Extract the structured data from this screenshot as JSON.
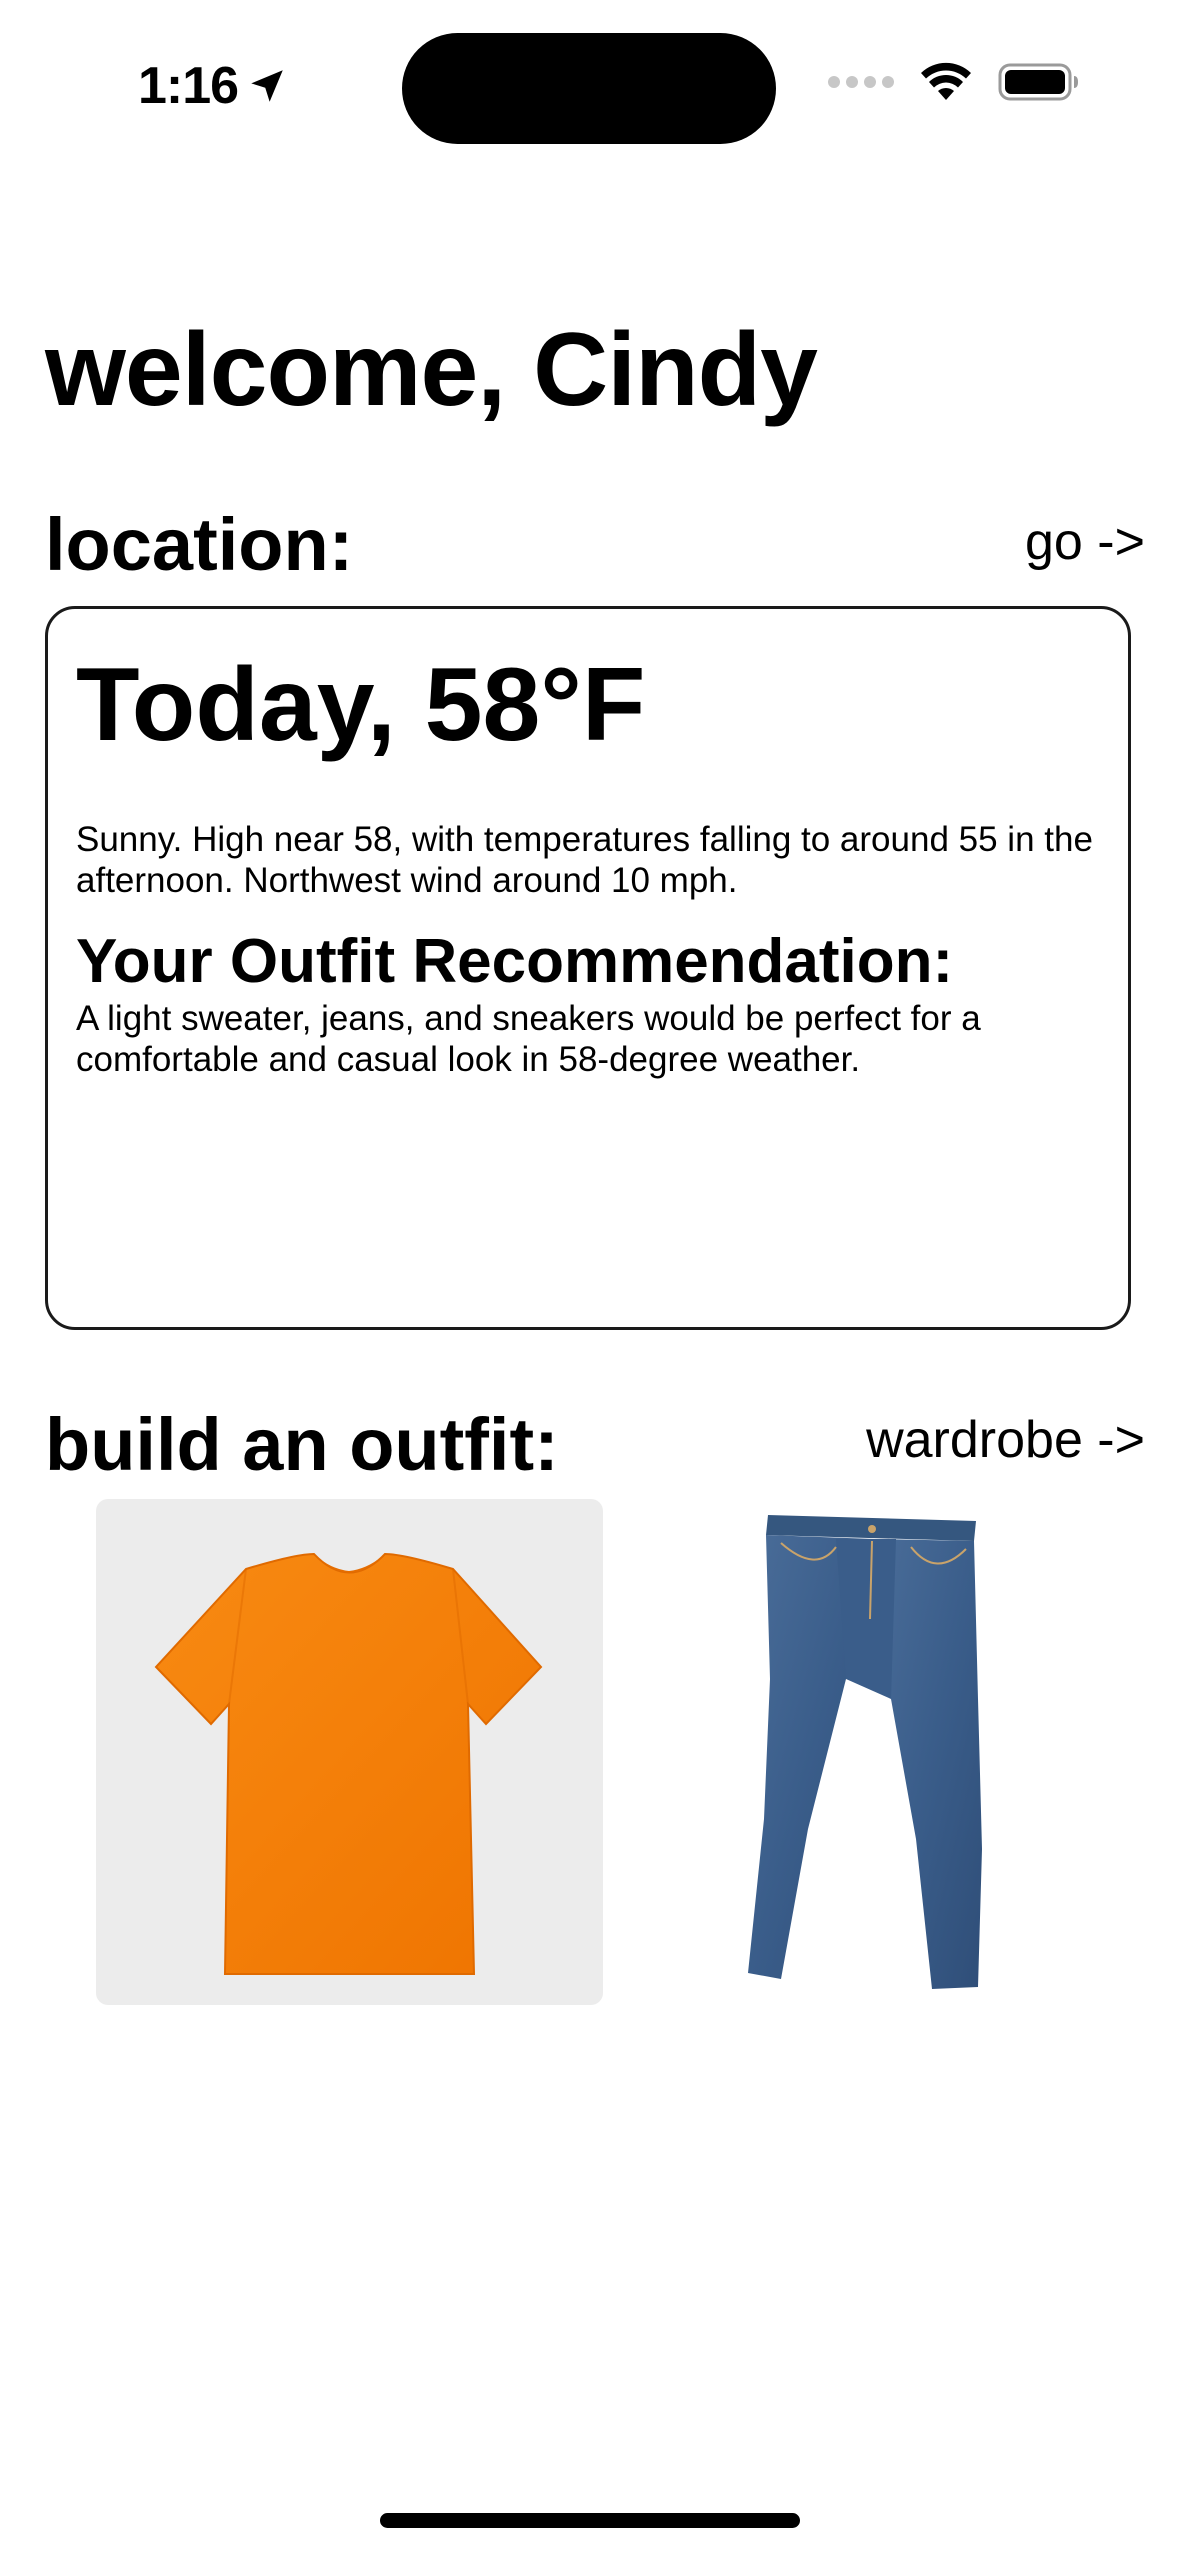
{
  "status_bar": {
    "time": "1:16",
    "icons": [
      "location-arrow-icon",
      "cellular-signal-icon",
      "wifi-icon",
      "battery-icon"
    ]
  },
  "greeting": "welcome, Cindy",
  "location_section": {
    "title": "location:",
    "link": "go ->"
  },
  "weather_card": {
    "headline": "Today, 58°F",
    "forecast": "Sunny. High near 58, with temperatures falling to around 55 in the afternoon. Northwest wind around 10 mph.",
    "recommendation_heading": "Your Outfit Recommendation:",
    "recommendation_text": "A light sweater, jeans, and sneakers would be perfect for a comfortable and casual look in 58-degree weather."
  },
  "outfit_section": {
    "title": "build an outfit:",
    "link": "wardrobe ->",
    "items": [
      {
        "name": "orange t-shirt",
        "color": "#f57c00"
      },
      {
        "name": "blue jeans",
        "color": "#3d5f8c"
      }
    ]
  },
  "colors": {
    "text": "#000000",
    "background": "#ffffff",
    "card_border": "#1a1a1a",
    "shirt_tile_bg": "#ececec"
  }
}
